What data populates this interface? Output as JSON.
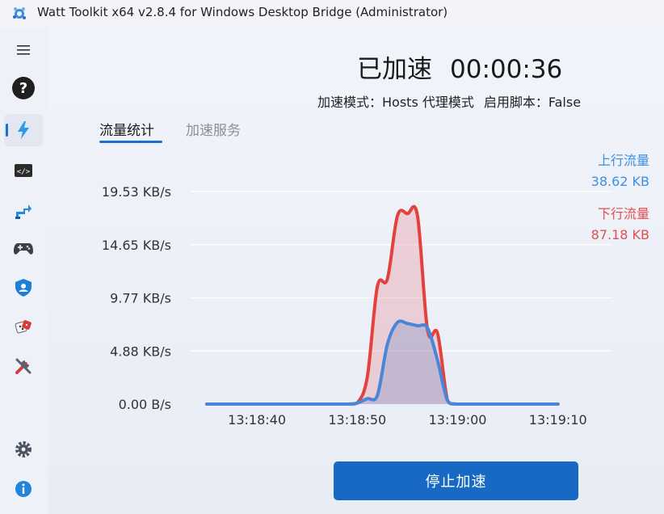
{
  "window": {
    "title": "Watt Toolkit x64 v2.8.4 for Windows Desktop Bridge (Administrator)"
  },
  "sidebar": {
    "items": [
      {
        "icon": "hamburger-menu-icon"
      },
      {
        "icon": "help-icon"
      },
      {
        "icon": "lightning-icon",
        "active": true
      },
      {
        "icon": "code-terminal-icon"
      },
      {
        "icon": "transfer-arrows-icon"
      },
      {
        "icon": "gamepad-icon"
      },
      {
        "icon": "shield-user-icon"
      },
      {
        "icon": "dice-icon"
      },
      {
        "icon": "tools-icon"
      },
      {
        "icon": "settings-gear-icon"
      },
      {
        "icon": "info-icon"
      }
    ]
  },
  "status": {
    "state": "已加速",
    "elapsed": "00:00:36",
    "mode_label": "加速模式：",
    "mode_value": "Hosts 代理模式",
    "script_label": "启用脚本：",
    "script_value": "False"
  },
  "tabs": [
    {
      "label": "流量统计",
      "active": true
    },
    {
      "label": "加速服务",
      "active": false
    }
  ],
  "legend": {
    "upload_label": "上行流量",
    "upload_total": "38.62 KB",
    "download_label": "下行流量",
    "download_total": "87.18 KB"
  },
  "button": {
    "stop_label": "停止加速"
  },
  "colors": {
    "accent": "#1769c4",
    "upload": "#4a86d8",
    "download": "#e5413c"
  },
  "chart_data": {
    "type": "area",
    "x": [
      "13:18:35",
      "13:18:40",
      "13:18:45",
      "13:18:49",
      "13:18:50",
      "13:18:51",
      "13:18:52",
      "13:18:53",
      "13:18:54",
      "13:18:55",
      "13:18:56",
      "13:18:57",
      "13:18:58",
      "13:18:59",
      "13:19:00",
      "13:19:05",
      "13:19:10"
    ],
    "xticks": [
      "13:18:40",
      "13:18:50",
      "13:19:00",
      "13:19:10"
    ],
    "yticks": [
      "19.53 KB/s",
      "14.65 KB/s",
      "9.77 KB/s",
      "4.88 KB/s",
      "0.00 B/s"
    ],
    "ylim": [
      0,
      19.53
    ],
    "grid": true,
    "series": [
      {
        "name": "上行流量",
        "values": [
          0,
          0,
          0,
          0,
          0.1,
          0.5,
          0.8,
          5.5,
          7.5,
          7.4,
          7.2,
          7.0,
          4.0,
          0.3,
          0,
          0,
          0
        ]
      },
      {
        "name": "下行流量",
        "values": [
          0,
          0,
          0,
          0,
          0.1,
          2.5,
          10.8,
          11.5,
          17.3,
          17.5,
          17.3,
          6.8,
          6.5,
          0.3,
          0,
          0,
          0
        ]
      }
    ],
    "legend_position": "top-right"
  }
}
